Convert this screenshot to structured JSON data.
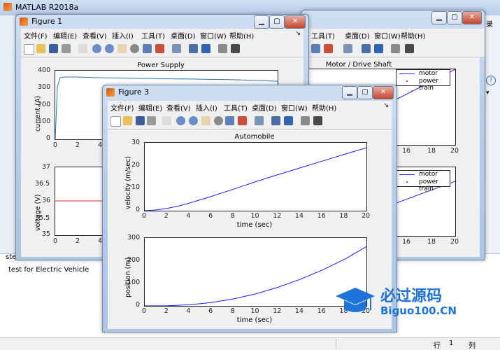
{
  "main_window": {
    "title": "MATLAB R2018a",
    "cmd_partial": "ste",
    "cmd_message": "test for Electric Vehicle",
    "right_tab": "录"
  },
  "statusbar": {
    "row_label": "行",
    "row_value": "1",
    "col_label": "列"
  },
  "menus": [
    "文件(F)",
    "编辑(E)",
    "查看(V)",
    "插入(I)",
    "工具(T)",
    "桌面(D)",
    "窗口(W)",
    "帮助(H)"
  ],
  "figure1": {
    "title": "Figure 1",
    "plot_top": {
      "title": "Power Supply",
      "ylabel": "current (A)",
      "yticks": [
        "400",
        "300",
        "200",
        "100",
        "0"
      ],
      "xticks": [
        "0",
        "2",
        "4"
      ]
    },
    "plot_bottom": {
      "ylabel": "voltage (V)",
      "yticks": [
        "37",
        "36.5",
        "36",
        "35.5",
        "35"
      ],
      "xticks": [
        "0",
        "2",
        "4"
      ]
    }
  },
  "figure2": {
    "plot_top": {
      "title": "Motor / Drive Shaft",
      "xticks": [
        "16",
        "18",
        "20"
      ]
    },
    "plot_bottom": {
      "xticks": [
        "16",
        "18",
        "20"
      ]
    },
    "legend": [
      "motor",
      "power train"
    ]
  },
  "figure3": {
    "title": "Figure 3",
    "plot_top": {
      "title": "Automobile",
      "ylabel": "velocity (m/sec)",
      "xlabel": "time (sec)",
      "yticks": [
        "30",
        "20",
        "10",
        "0"
      ],
      "xticks": [
        "0",
        "2",
        "4",
        "6",
        "8",
        "10",
        "12",
        "14",
        "16",
        "18",
        "20"
      ]
    },
    "plot_bottom": {
      "ylabel": "position (m)",
      "xlabel": "time (sec)",
      "yticks": [
        "300",
        "200",
        "100",
        "0"
      ],
      "xticks": [
        "0",
        "2",
        "4",
        "6",
        "8",
        "10",
        "12",
        "14",
        "16",
        "18",
        "20"
      ]
    }
  },
  "watermark": {
    "text_cn": "必过源码",
    "text_en": "Biguo100.CN"
  },
  "chart_data": [
    {
      "type": "line",
      "title": "Power Supply",
      "ylabel": "current (A)",
      "xlim": [
        0,
        20
      ],
      "ylim": [
        0,
        400
      ],
      "series": [
        {
          "x": [
            0,
            0.2,
            0.5,
            1,
            2,
            4,
            8,
            12,
            16,
            20
          ],
          "values": [
            0,
            300,
            355,
            360,
            358,
            355,
            350,
            345,
            340,
            335
          ]
        }
      ]
    },
    {
      "type": "line",
      "ylabel": "voltage (V)",
      "xlim": [
        0,
        20
      ],
      "ylim": [
        35,
        37
      ],
      "series": [
        {
          "x": [
            0,
            20
          ],
          "values": [
            36,
            36
          ]
        }
      ]
    },
    {
      "type": "line",
      "title": "Automobile",
      "xlabel": "time (sec)",
      "ylabel": "velocity (m/sec)",
      "xlim": [
        0,
        20
      ],
      "ylim": [
        0,
        30
      ],
      "series": [
        {
          "x": [
            0,
            1,
            2,
            3,
            4,
            6,
            8,
            10,
            12,
            14,
            16,
            18,
            20
          ],
          "values": [
            0,
            0.3,
            1,
            2,
            3.3,
            6.3,
            9.5,
            12.8,
            15.9,
            18.9,
            21.9,
            24.9,
            27.8
          ]
        }
      ]
    },
    {
      "type": "line",
      "xlabel": "time (sec)",
      "ylabel": "position (m)",
      "xlim": [
        0,
        20
      ],
      "ylim": [
        0,
        300
      ],
      "series": [
        {
          "x": [
            0,
            2,
            4,
            6,
            8,
            10,
            12,
            14,
            16,
            18,
            20
          ],
          "values": [
            0,
            0.5,
            5,
            15,
            31,
            53,
            82,
            117,
            158,
            205,
            262
          ]
        }
      ]
    }
  ]
}
